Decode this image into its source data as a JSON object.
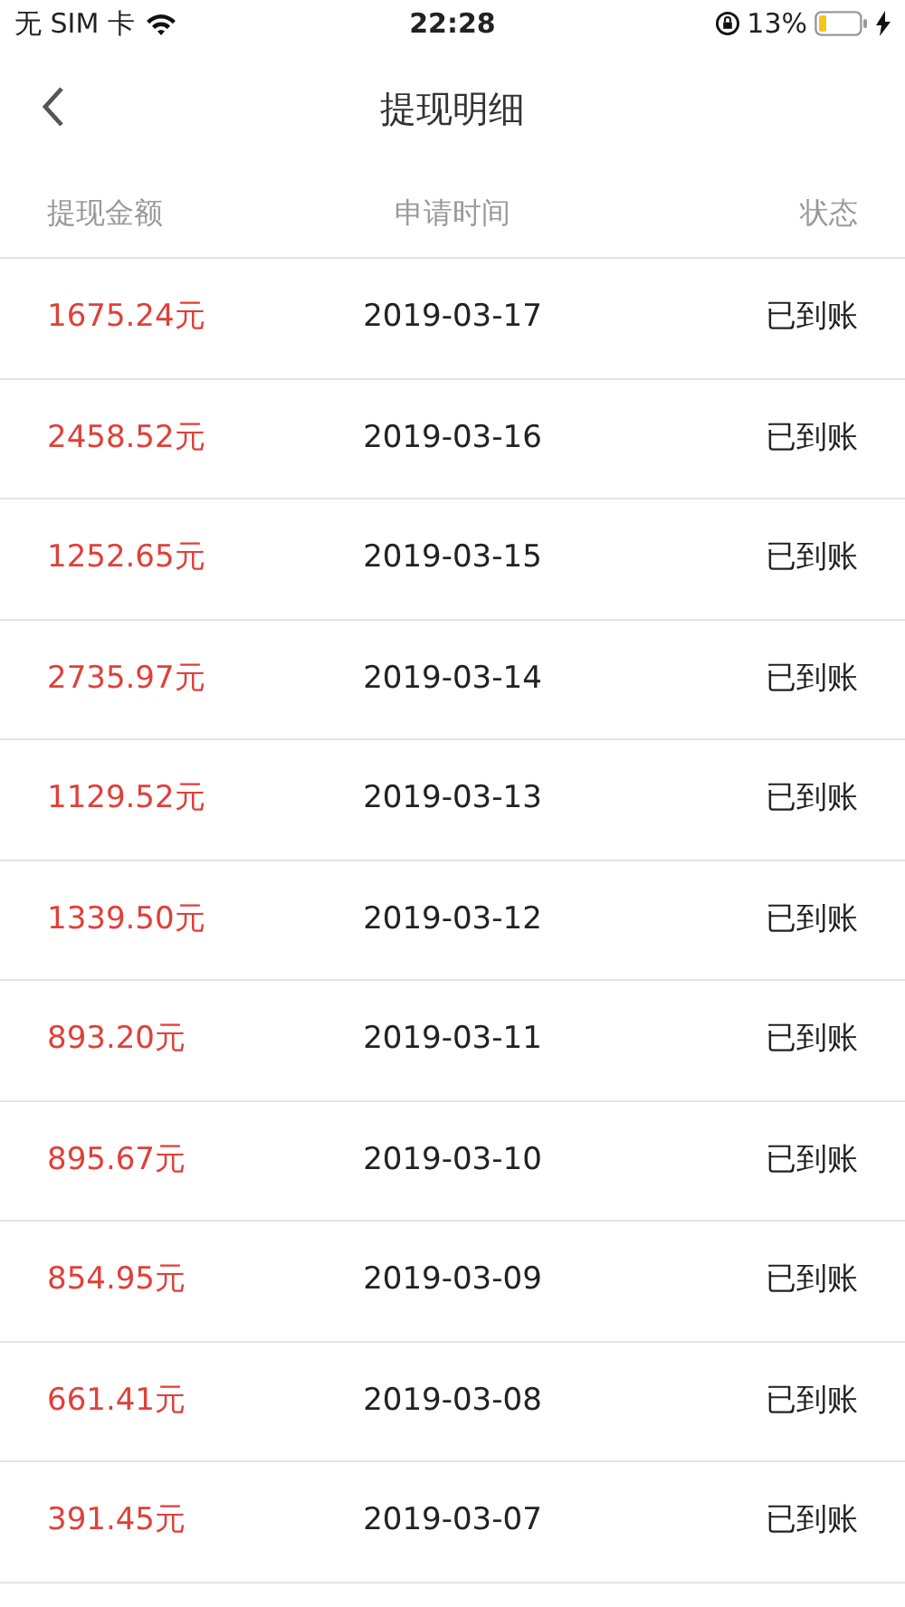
{
  "status_bar": {
    "carrier": "无 SIM 卡",
    "time": "22:28",
    "battery": "13%"
  },
  "header": {
    "title": "提现明细"
  },
  "table": {
    "columns": [
      "提现金额",
      "申请时间",
      "状态"
    ],
    "rows": [
      {
        "amount": "1675.24元",
        "date": "2019-03-17",
        "status": "已到账"
      },
      {
        "amount": "2458.52元",
        "date": "2019-03-16",
        "status": "已到账"
      },
      {
        "amount": "1252.65元",
        "date": "2019-03-15",
        "status": "已到账"
      },
      {
        "amount": "2735.97元",
        "date": "2019-03-14",
        "status": "已到账"
      },
      {
        "amount": "1129.52元",
        "date": "2019-03-13",
        "status": "已到账"
      },
      {
        "amount": "1339.50元",
        "date": "2019-03-12",
        "status": "已到账"
      },
      {
        "amount": "893.20元",
        "date": "2019-03-11",
        "status": "已到账"
      },
      {
        "amount": "895.67元",
        "date": "2019-03-10",
        "status": "已到账"
      },
      {
        "amount": "854.95元",
        "date": "2019-03-09",
        "status": "已到账"
      },
      {
        "amount": "661.41元",
        "date": "2019-03-08",
        "status": "已到账"
      },
      {
        "amount": "391.45元",
        "date": "2019-03-07",
        "status": "已到账"
      }
    ]
  }
}
